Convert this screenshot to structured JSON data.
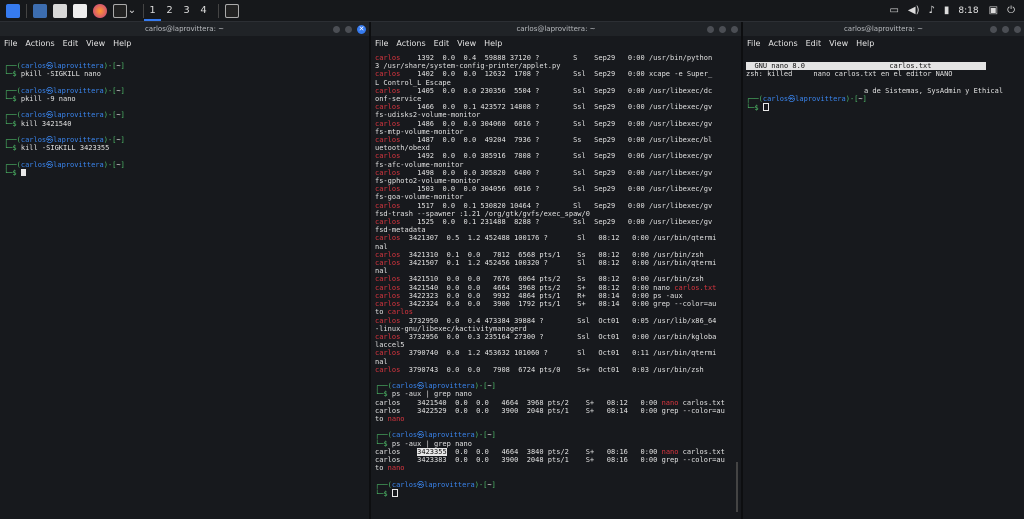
{
  "taskbar": {
    "workspaces": [
      "1",
      "2",
      "3",
      "4"
    ],
    "clock": "8:18"
  },
  "left": {
    "title": "carlos@laprovittera: ~",
    "menu": [
      "File",
      "Actions",
      "Edit",
      "View",
      "Help"
    ],
    "user": "carlos",
    "host": "laprovittera",
    "dir": "~",
    "commands": [
      "pkill -SIGKILL nano",
      "pkill -9 nano",
      "kill 3421540",
      "kill -SIGKILL 3423355"
    ]
  },
  "mid": {
    "title": "carlos@laprovittera: ~",
    "menu": [
      "File",
      "Actions",
      "Edit",
      "View",
      "Help"
    ],
    "ps_lines": [
      [
        "carlos",
        "    1392  0.0  0.4  59888 37120 ?        S    Sep29   0:00 /usr/bin/python"
      ],
      [
        "",
        "3 /usr/share/system-config-printer/applet.py"
      ],
      [
        "carlos",
        "    1402  0.0  0.0  12632  1708 ?        Ssl  Sep29   0:00 xcape -e Super_"
      ],
      [
        "",
        "L Control_L Escape"
      ],
      [
        "carlos",
        "    1405  0.0  0.0 230356  5504 ?        Ssl  Sep29   0:00 /usr/libexec/dc"
      ],
      [
        "",
        "onf-service"
      ],
      [
        "carlos",
        "    1466  0.0  0.1 423572 14808 ?        Ssl  Sep29   0:00 /usr/libexec/gv"
      ],
      [
        "",
        "fs-udisks2-volume-monitor"
      ],
      [
        "carlos",
        "    1486  0.0  0.0 304060  6016 ?        Ssl  Sep29   0:00 /usr/libexec/gv"
      ],
      [
        "",
        "fs-mtp-volume-monitor"
      ],
      [
        "carlos",
        "    1487  0.0  0.0  49204  7936 ?        Ss   Sep29   0:00 /usr/libexec/bl"
      ],
      [
        "",
        "uetooth/obexd"
      ],
      [
        "carlos",
        "    1492  0.0  0.0 385916  7808 ?        Ssl  Sep29   0:06 /usr/libexec/gv"
      ],
      [
        "",
        "fs-afc-volume-monitor"
      ],
      [
        "carlos",
        "    1498  0.0  0.0 305820  6400 ?        Ssl  Sep29   0:00 /usr/libexec/gv"
      ],
      [
        "",
        "fs-gphoto2-volume-monitor"
      ],
      [
        "carlos",
        "    1503  0.0  0.0 304056  6016 ?        Ssl  Sep29   0:00 /usr/libexec/gv"
      ],
      [
        "",
        "fs-goa-volume-monitor"
      ],
      [
        "carlos",
        "    1517  0.0  0.1 530820 10464 ?        Sl   Sep29   0:00 /usr/libexec/gv"
      ],
      [
        "",
        "fsd-trash --spawner :1.21 /org/gtk/gvfs/exec_spaw/0"
      ],
      [
        "carlos",
        "    1525  0.0  0.1 231488  8288 ?        Ssl  Sep29   0:00 /usr/libexec/gv"
      ],
      [
        "",
        "fsd-metadata"
      ],
      [
        "carlos",
        "  3421307  0.5  1.2 452488 100176 ?       Sl   08:12   0:00 /usr/bin/qtermi"
      ],
      [
        "",
        "nal"
      ],
      [
        "carlos",
        "  3421310  0.1  0.0   7812  6568 pts/1    Ss   08:12   0:00 /usr/bin/zsh"
      ],
      [
        "carlos",
        "  3421507  0.1  1.2 452456 100320 ?       Sl   08:12   0:00 /usr/bin/qtermi"
      ],
      [
        "",
        "nal"
      ],
      [
        "carlos",
        "  3421510  0.0  0.0   7676  6064 pts/2    Ss   08:12   0:00 /usr/bin/zsh"
      ],
      [
        "carlos",
        "  3421540  0.0  0.0   4664  3968 pts/2    S+   08:12   0:00 nano |carlos.txt"
      ],
      [
        "carlos",
        "  3422323  0.0  0.0   9932  4864 pts/1    R+   08:14   0:00 ps -aux"
      ],
      [
        "carlos",
        "  3422324  0.0  0.0   3900  1792 pts/1    S+   08:14   0:00 grep --color=au"
      ],
      [
        "",
        "to |carlos"
      ],
      [
        "carlos",
        "  3732950  0.0  0.4 473384 39884 ?        Ssl  Oct01   0:05 /usr/lib/x86_64"
      ],
      [
        "",
        "-linux-gnu/libexec/kactivitymanagerd"
      ],
      [
        "carlos",
        "  3732956  0.0  0.3 235164 27300 ?        Ssl  Oct01   0:00 /usr/bin/kgloba"
      ],
      [
        "",
        "laccel5"
      ],
      [
        "carlos",
        "  3790740  0.0  1.2 453632 101060 ?       Sl   Oct01   0:11 /usr/bin/qtermi"
      ],
      [
        "",
        "nal"
      ],
      [
        "carlos",
        "  3790743  0.0  0.0   7908  6724 pts/0    Ss+  Oct01   0:03 /usr/bin/zsh"
      ]
    ],
    "grep_cmd": "ps -aux | grep nano",
    "grep1": [
      "carlos    3421540  0.0  0.0   4664  3968 pts/2    S+   08:12   0:00 ",
      "carlos    3422529  0.0  0.0   3900  2048 pts/1    S+   08:14   0:00 grep --color=au"
    ],
    "grep1_tail": [
      "nano",
      " carlos.txt",
      "to ",
      "nano"
    ],
    "grep2_pre": "carlos    ",
    "grep2_pid": "3423355",
    "grep2_rest": "  0.0  0.0   4664  3840 pts/2    S+   08:16   0:00 ",
    "grep2_line2": "carlos    3423383  0.0  0.0   3900  2048 pts/1    S+   08:16   0:00 grep --color=au"
  },
  "right": {
    "title": "carlos@laprovittera: ~",
    "menu": [
      "File",
      "Actions",
      "Edit",
      "View",
      "Help"
    ],
    "nano_version": "GNU nano 8.0",
    "nano_file": "carlos.txt",
    "killed_line": "zsh: killed     nano carlos.txt en el editor NANO",
    "wrapped": "a de Sistemas, SysAdmin y Ethical"
  },
  "prompt": {
    "open": "┌──(",
    "close": ")-[",
    "end": "]",
    "second": "└─$ ",
    "skull": "㉿"
  }
}
